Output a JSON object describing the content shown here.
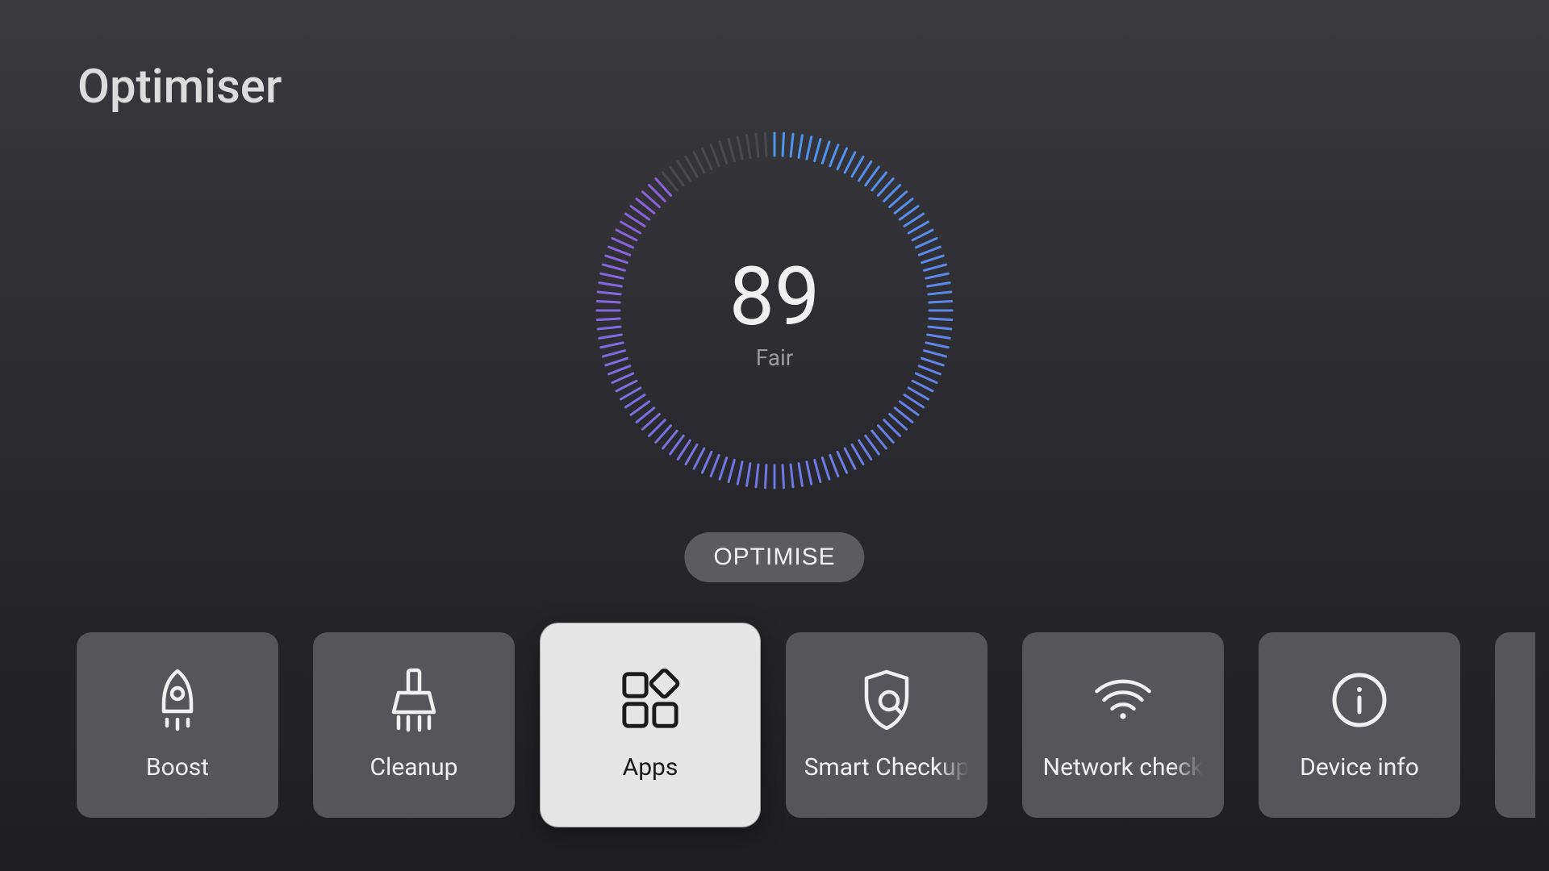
{
  "page_title": "Optimiser",
  "gauge": {
    "score": "89",
    "status_label": "Fair",
    "percent": 89
  },
  "optimise_button_label": "OPTIMISE",
  "tiles": [
    {
      "id": "boost",
      "label": "Boost"
    },
    {
      "id": "cleanup",
      "label": "Cleanup"
    },
    {
      "id": "apps",
      "label": "Apps",
      "selected": true
    },
    {
      "id": "smart-checkup",
      "label": "Smart Checkup"
    },
    {
      "id": "network-check",
      "label": "Network check"
    },
    {
      "id": "device-info",
      "label": "Device info"
    }
  ]
}
